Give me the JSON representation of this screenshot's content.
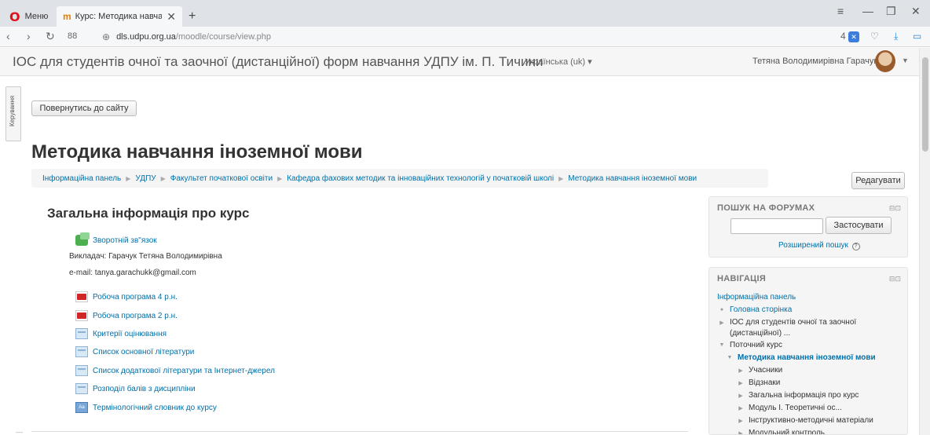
{
  "browser": {
    "menu_label": "Меню",
    "tab_title": "Курс: Методика навчання",
    "url_domain": "dls.udpu.org.ua",
    "url_path": "/moodle/course/view.php",
    "badge_count": "4"
  },
  "header": {
    "site_name": "ІОС для студентів очної та заочної (дистанційної) форм навчання УДПУ ім. П. Тичини",
    "language": "Українська (uk) ▾",
    "user_name": "Тетяна Володимирівна Гарачук"
  },
  "dock_label": "Керування",
  "back_button": "Повернутись до сайту",
  "course_title": "Методика навчання іноземної мови",
  "breadcrumb": [
    "Інформаційна панель",
    "УДПУ",
    "Факультет початкової освіти",
    "Кафедра фахових методик та інноваційних технологій у початковій школі",
    "Методика навчання іноземної мови"
  ],
  "edit_button": "Редагувати",
  "section": {
    "title": "Загальна інформація про курс",
    "feedback_link": "Зворотній зв\"язок",
    "teacher": "Викладач: Гарачук Тетяна Володимирівна",
    "email": "e-mail: tanya.garachukk@gmail.com",
    "resources": [
      {
        "label": "Робоча програма 4 р.н.",
        "icon": "pdf-icon"
      },
      {
        "label": "Робоча програма 2 р.н.",
        "icon": "pdf-icon"
      },
      {
        "label": "Критерії оцінювання",
        "icon": "file-icon"
      },
      {
        "label": "Список основної літератури",
        "icon": "file-icon"
      },
      {
        "label": "Список додаткової літератури та Інтернет-джерел",
        "icon": "file-icon"
      },
      {
        "label": "Розподіл балів з дисципліни",
        "icon": "file-icon"
      },
      {
        "label": "Термінологічний словник до курсу",
        "icon": "glossary-icon"
      }
    ]
  },
  "search_block": {
    "title": "ПОШУК НА ФОРУМАХ",
    "apply_button": "Застосувати",
    "advanced_link": "Розширений пошук",
    "input_value": ""
  },
  "nav_block": {
    "title": "НАВІГАЦІЯ",
    "dashboard": "Інформаційна панель",
    "home": "Головна сторінка",
    "site_line1": "ІОС для студентів очної та заочної",
    "site_line2": "(дистанційної) ...",
    "current_course": "Поточний курс",
    "course": "Методика навчання іноземної мови",
    "children": [
      "Учасники",
      "Відзнаки",
      "Загальна інформація про курс",
      "Модуль І. Теоретичні ос...",
      "Інструктивно-методичні матеріали",
      "Модульний контроль"
    ]
  }
}
